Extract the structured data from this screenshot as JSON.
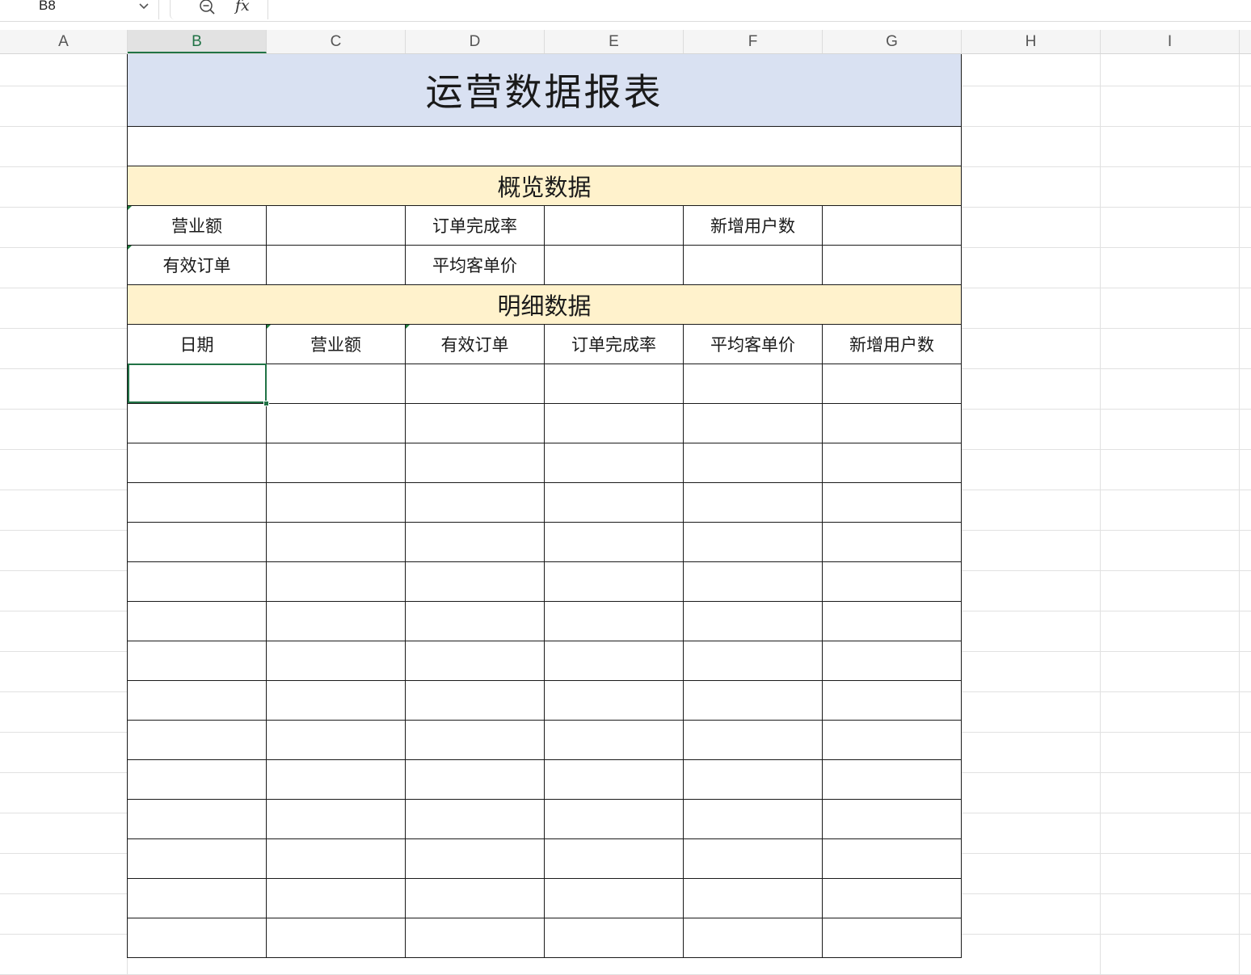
{
  "formula_bar": {
    "name_box": "B8",
    "fx_label": "𝑓𝑥",
    "formula_value": ""
  },
  "columns": [
    "A",
    "B",
    "C",
    "D",
    "E",
    "F",
    "G",
    "H",
    "I"
  ],
  "selected_column": "B",
  "report": {
    "title": "运营数据报表",
    "overview": {
      "heading": "概览数据",
      "row1": [
        "营业额",
        "",
        "订单完成率",
        "",
        "新增用户数",
        ""
      ],
      "row2": [
        "有效订单",
        "",
        "平均客单价",
        "",
        "",
        ""
      ]
    },
    "detail": {
      "heading": "明细数据",
      "columns": [
        "日期",
        "营业额",
        "有效订单",
        "订单完成率",
        "平均客单价",
        "新增用户数"
      ]
    }
  },
  "colors": {
    "title_fill": "#d9e1f2",
    "section_fill": "#fff2cc",
    "selection_accent": "#217346"
  }
}
